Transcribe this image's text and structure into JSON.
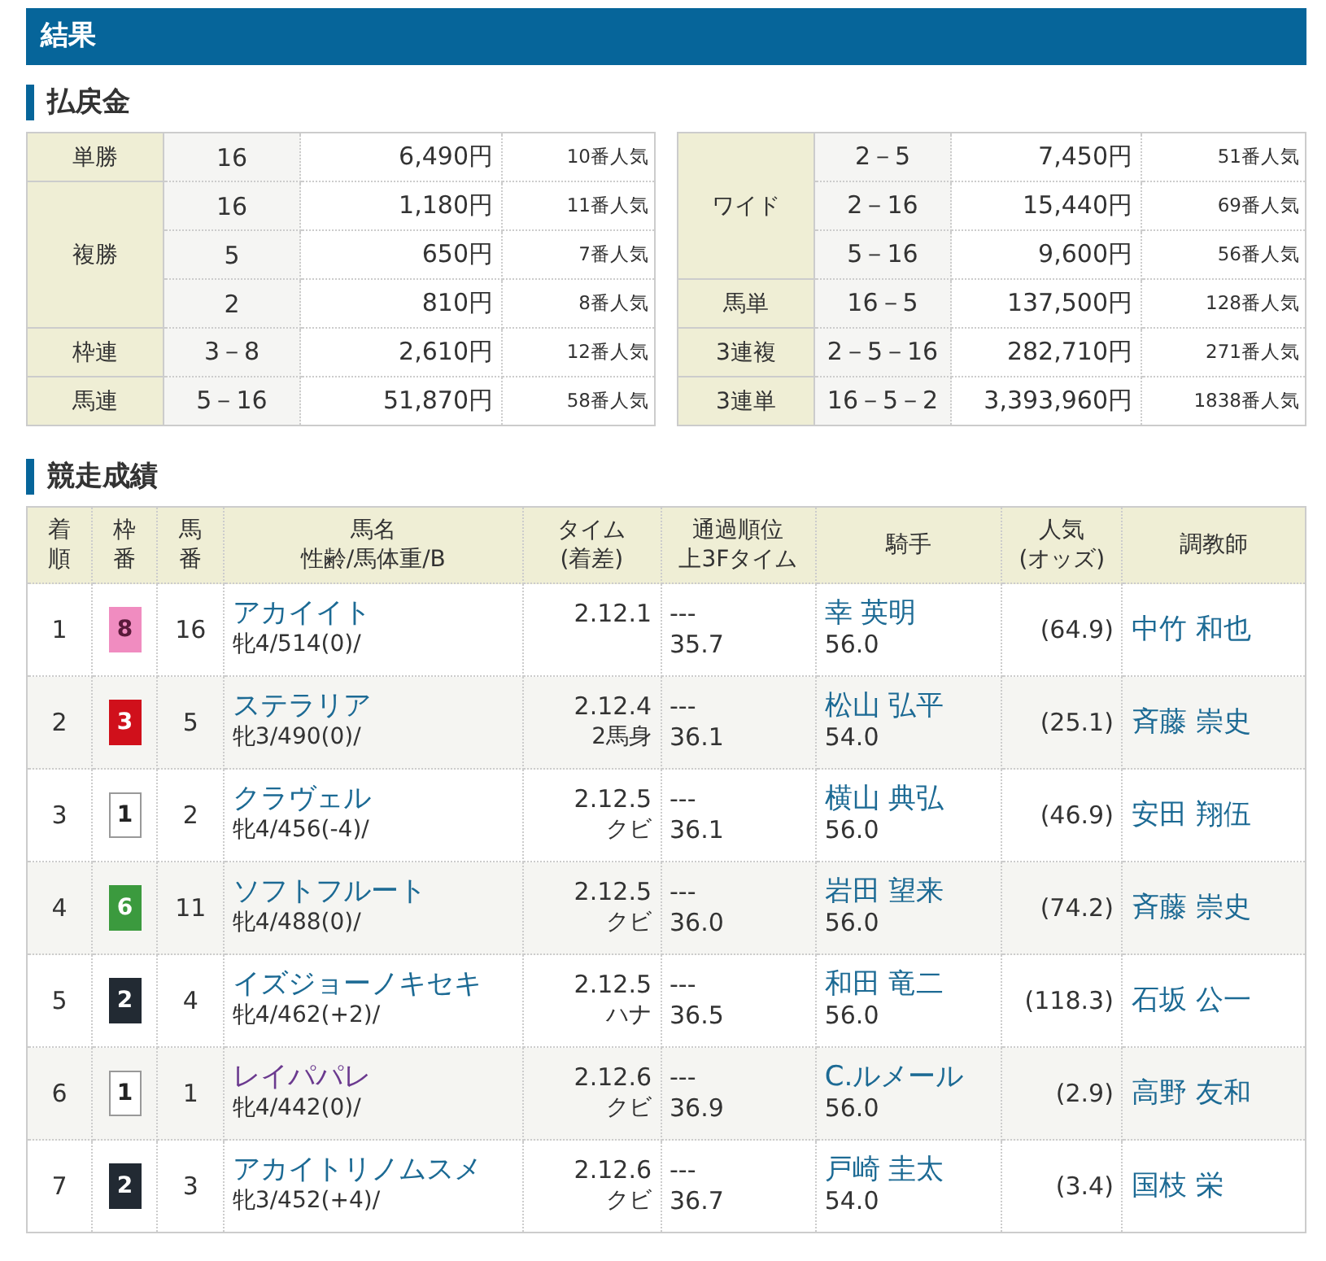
{
  "header": "結果",
  "payout": {
    "title": "払戻金",
    "tables": [
      [
        {
          "label": "単勝",
          "rows": [
            {
              "numbers": "16",
              "amount": "6,490円",
              "popularity": "10番人気"
            }
          ]
        },
        {
          "label": "複勝",
          "rows": [
            {
              "numbers": "16",
              "amount": "1,180円",
              "popularity": "11番人気"
            },
            {
              "numbers": "5",
              "amount": "650円",
              "popularity": "7番人気"
            },
            {
              "numbers": "2",
              "amount": "810円",
              "popularity": "8番人気"
            }
          ]
        },
        {
          "label": "枠連",
          "rows": [
            {
              "numbers": "3－8",
              "amount": "2,610円",
              "popularity": "12番人気"
            }
          ]
        },
        {
          "label": "馬連",
          "rows": [
            {
              "numbers": "5－16",
              "amount": "51,870円",
              "popularity": "58番人気"
            }
          ]
        }
      ],
      [
        {
          "label": "ワイド",
          "rows": [
            {
              "numbers": "2－5",
              "amount": "7,450円",
              "popularity": "51番人気"
            },
            {
              "numbers": "2－16",
              "amount": "15,440円",
              "popularity": "69番人気"
            },
            {
              "numbers": "5－16",
              "amount": "9,600円",
              "popularity": "56番人気"
            }
          ]
        },
        {
          "label": "馬単",
          "rows": [
            {
              "numbers": "16－5",
              "amount": "137,500円",
              "popularity": "128番人気"
            }
          ]
        },
        {
          "label": "3連複",
          "rows": [
            {
              "numbers": "2－5－16",
              "amount": "282,710円",
              "popularity": "271番人気"
            }
          ]
        },
        {
          "label": "3連単",
          "rows": [
            {
              "numbers": "16－5－2",
              "amount": "3,393,960円",
              "popularity": "1838番人気"
            }
          ]
        }
      ]
    ]
  },
  "results": {
    "title": "競走成績",
    "columns": [
      [
        "着",
        "順"
      ],
      [
        "枠",
        "番"
      ],
      [
        "馬",
        "番"
      ],
      [
        "馬名",
        "性齢/馬体重/B"
      ],
      [
        "タイム",
        "(着差)"
      ],
      [
        "通過順位",
        "上3Fタイム"
      ],
      [
        "騎手"
      ],
      [
        "人気",
        "(オッズ)"
      ],
      [
        "調教師"
      ]
    ],
    "rows": [
      {
        "rank": "1",
        "frame": {
          "number": "8",
          "color": "#f08cc0"
        },
        "horse_no": "16",
        "horse": "アカイイト",
        "visited": false,
        "info": "牝4/514(0)/",
        "time": "2.12.1",
        "margin": "",
        "passing": "---",
        "last3f": "35.7",
        "jockey": "幸 英明",
        "weight": "56.0",
        "odds": "(64.9)",
        "trainer": "中竹 和也"
      },
      {
        "rank": "2",
        "frame": {
          "number": "3",
          "color": "#d0101b"
        },
        "horse_no": "5",
        "horse": "ステラリア",
        "visited": false,
        "info": "牝3/490(0)/",
        "time": "2.12.4",
        "margin": "2馬身",
        "passing": "---",
        "last3f": "36.1",
        "jockey": "松山 弘平",
        "weight": "54.0",
        "odds": "(25.1)",
        "trainer": "斉藤 崇史"
      },
      {
        "rank": "3",
        "frame": {
          "number": "1",
          "color": "#ffffff"
        },
        "horse_no": "2",
        "horse": "クラヴェル",
        "visited": false,
        "info": "牝4/456(-4)/",
        "time": "2.12.5",
        "margin": "クビ",
        "passing": "---",
        "last3f": "36.1",
        "jockey": "横山 典弘",
        "weight": "56.0",
        "odds": "(46.9)",
        "trainer": "安田 翔伍"
      },
      {
        "rank": "4",
        "frame": {
          "number": "6",
          "color": "#3b9a3e"
        },
        "horse_no": "11",
        "horse": "ソフトフルート",
        "visited": false,
        "info": "牝4/488(0)/",
        "time": "2.12.5",
        "margin": "クビ",
        "passing": "---",
        "last3f": "36.0",
        "jockey": "岩田 望来",
        "weight": "56.0",
        "odds": "(74.2)",
        "trainer": "斉藤 崇史"
      },
      {
        "rank": "5",
        "frame": {
          "number": "2",
          "color": "#222a33"
        },
        "horse_no": "4",
        "horse": "イズジョーノキセキ",
        "visited": false,
        "info": "牝4/462(+2)/",
        "time": "2.12.5",
        "margin": "ハナ",
        "passing": "---",
        "last3f": "36.5",
        "jockey": "和田 竜二",
        "weight": "56.0",
        "odds": "(118.3)",
        "trainer": "石坂 公一"
      },
      {
        "rank": "6",
        "frame": {
          "number": "1",
          "color": "#ffffff"
        },
        "horse_no": "1",
        "horse": "レイパパレ",
        "visited": true,
        "info": "牝4/442(0)/",
        "time": "2.12.6",
        "margin": "クビ",
        "passing": "---",
        "last3f": "36.9",
        "jockey": "C.ルメール",
        "weight": "56.0",
        "odds": "(2.9)",
        "trainer": "高野 友和"
      },
      {
        "rank": "7",
        "frame": {
          "number": "2",
          "color": "#222a33"
        },
        "horse_no": "3",
        "horse": "アカイトリノムスメ",
        "visited": false,
        "info": "牝3/452(+4)/",
        "time": "2.12.6",
        "margin": "クビ",
        "passing": "---",
        "last3f": "36.7",
        "jockey": "戸崎 圭太",
        "weight": "54.0",
        "odds": "(3.4)",
        "trainer": "国枝 栄"
      }
    ]
  }
}
